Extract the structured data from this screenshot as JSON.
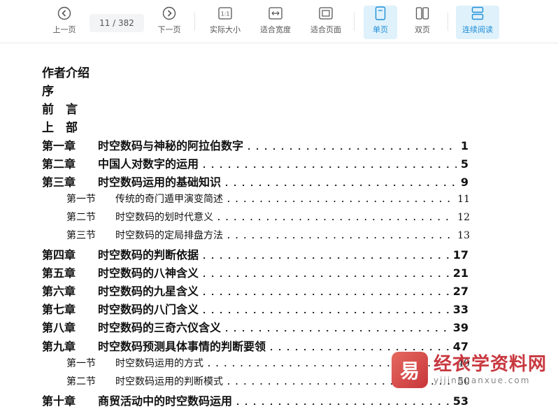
{
  "toolbar": {
    "prev_label": "上一页",
    "page_indicator": "11 / 382",
    "next_label": "下一页",
    "actual_size_label": "实际大小",
    "fit_width_label": "适合宽度",
    "fit_page_label": "适合页面",
    "single_page_label": "单页",
    "double_page_label": "双页",
    "continuous_label": "连续阅读",
    "accent_color": "#1f8fd6"
  },
  "toc": {
    "headings": [
      "作者介绍",
      "序",
      "前　言",
      "上　部"
    ],
    "entries": [
      {
        "level": "chapter",
        "num": "第一章",
        "title": "时空数码与神秘的阿拉伯数字",
        "page": "1"
      },
      {
        "level": "chapter",
        "num": "第二章",
        "title": "中国人对数字的运用",
        "page": "5"
      },
      {
        "level": "chapter",
        "num": "第三章",
        "title": "时空数码运用的基础知识",
        "page": "9"
      },
      {
        "level": "section",
        "num": "第一节",
        "title": "传统的奇门遁甲演变简述",
        "page": "11"
      },
      {
        "level": "section",
        "num": "第二节",
        "title": "时空数码的划时代意义",
        "page": "12"
      },
      {
        "level": "section",
        "num": "第三节",
        "title": "时空数码的定局排盘方法",
        "page": "13"
      },
      {
        "level": "chapter",
        "num": "第四章",
        "title": "时空数码的判断依据",
        "page": "17"
      },
      {
        "level": "chapter",
        "num": "第五章",
        "title": "时空数码的八神含义",
        "page": "21"
      },
      {
        "level": "chapter",
        "num": "第六章",
        "title": "时空数码的九星含义",
        "page": "27"
      },
      {
        "level": "chapter",
        "num": "第七章",
        "title": "时空数码的八门含义",
        "page": "33"
      },
      {
        "level": "chapter",
        "num": "第八章",
        "title": "时空数码的三奇六仪含义",
        "page": "39"
      },
      {
        "level": "chapter",
        "num": "第九章",
        "title": "时空数码预测具体事情的判断要领",
        "page": "47"
      },
      {
        "level": "section",
        "num": "第一节",
        "title": "时空数码运用的方式",
        "page": "49"
      },
      {
        "level": "section",
        "num": "第二节",
        "title": "时空数码运用的判断模式",
        "page": "50"
      },
      {
        "level": "chapter",
        "num": "第十章",
        "title": "商贸活动中的时空数码运用",
        "page": "53"
      }
    ]
  },
  "watermark": {
    "title": "经衣学资料网",
    "url": "yijinquanxue.com"
  }
}
